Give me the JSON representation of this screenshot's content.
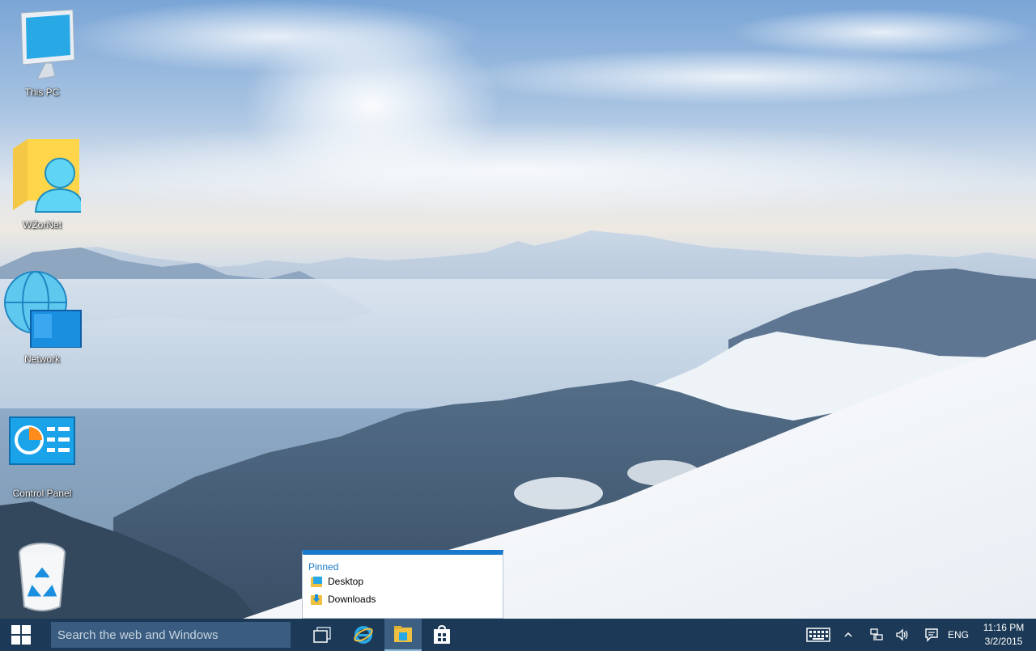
{
  "desktop": {
    "icons": [
      {
        "label": "This PC"
      },
      {
        "label": "WZorNet"
      },
      {
        "label": "Network"
      },
      {
        "label": "Control Panel"
      },
      {
        "label": "Recycle Bin"
      }
    ]
  },
  "jumplist": {
    "heading": "Pinned",
    "items": [
      {
        "label": "Desktop",
        "icon": "desktop-folder-icon"
      },
      {
        "label": "Downloads",
        "icon": "downloads-folder-icon"
      }
    ]
  },
  "taskbar": {
    "start_icon": "windows-logo-icon",
    "search_placeholder": "Search the web and Windows",
    "apps": [
      {
        "name": "task-view",
        "icon": "task-view-icon"
      },
      {
        "name": "internet-explorer",
        "icon": "internet-explorer-icon"
      },
      {
        "name": "file-explorer",
        "icon": "file-explorer-icon",
        "active": true
      },
      {
        "name": "store",
        "icon": "store-icon"
      }
    ],
    "tray": {
      "keyboard_icon": "touch-keyboard-icon",
      "chevron_icon": "show-hidden-icons-chevron",
      "network_icon": "network-icon",
      "volume_icon": "volume-icon",
      "action_center_icon": "action-center-icon",
      "language": "ENG",
      "time": "11:16 PM",
      "date": "3/2/2015"
    }
  },
  "colors": {
    "taskbar_bg": "#1c3a57",
    "search_bg": "#3a5c80",
    "accent": "#1979ca"
  }
}
